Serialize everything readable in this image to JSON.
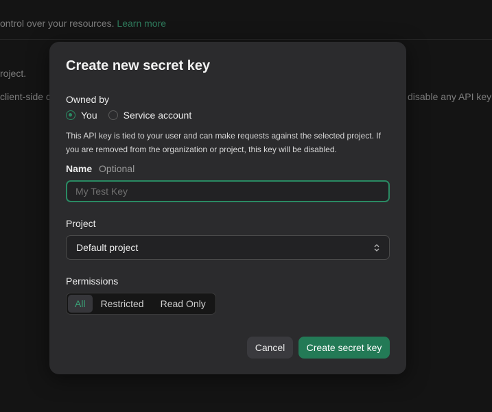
{
  "background": {
    "line1_text": "ontrol over your resources.",
    "line1_link": "Learn more",
    "line2_text": "roject.",
    "line3_left": "client-side c",
    "line3_right": "disable any API key"
  },
  "modal": {
    "title": "Create new secret key",
    "owned_by_label": "Owned by",
    "owner_options": [
      {
        "label": "You",
        "checked": true
      },
      {
        "label": "Service account",
        "checked": false
      }
    ],
    "help_text": "This API key is tied to your user and can make requests against the selected project. If you are removed from the organization or project, this key will be disabled.",
    "name_label": "Name",
    "name_optional": "Optional",
    "name_value": "",
    "name_placeholder": "My Test Key",
    "project_label": "Project",
    "project_value": "Default project",
    "permissions_label": "Permissions",
    "permission_options": [
      {
        "label": "All",
        "active": true
      },
      {
        "label": "Restricted",
        "active": false
      },
      {
        "label": "Read Only",
        "active": false
      }
    ],
    "cancel_label": "Cancel",
    "create_label": "Create secret key"
  },
  "colors": {
    "accent": "#2a8a63",
    "primary_button": "#237a56",
    "modal_bg": "#2b2b2d",
    "page_bg": "#141414"
  },
  "icons": {
    "select": "chevron-up-down-icon",
    "radio": "radio-icon"
  }
}
